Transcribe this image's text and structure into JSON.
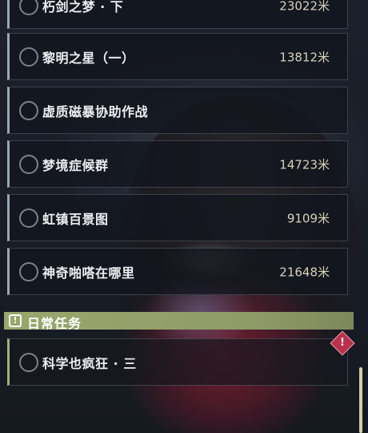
{
  "quests": [
    {
      "name": "朽剑之梦 · 下",
      "distance": "23022米"
    },
    {
      "name": "黎明之星（一）",
      "distance": "13812米"
    },
    {
      "name": "虚质磁暴协助作战",
      "distance": ""
    },
    {
      "name": "梦境症候群",
      "distance": "14723米"
    },
    {
      "name": "虹镇百景图",
      "distance": "9109米"
    },
    {
      "name": "神奇啪嗒在哪里",
      "distance": "21648米"
    }
  ],
  "section": {
    "title": "日常任务",
    "icon": "!"
  },
  "daily": {
    "name": "科学也疯狂 · 三",
    "alert_icon": "!"
  },
  "colors": {
    "section_bar": "#9aa66d",
    "distance_text": "#d8d2b8",
    "alert": "#b8324e"
  }
}
